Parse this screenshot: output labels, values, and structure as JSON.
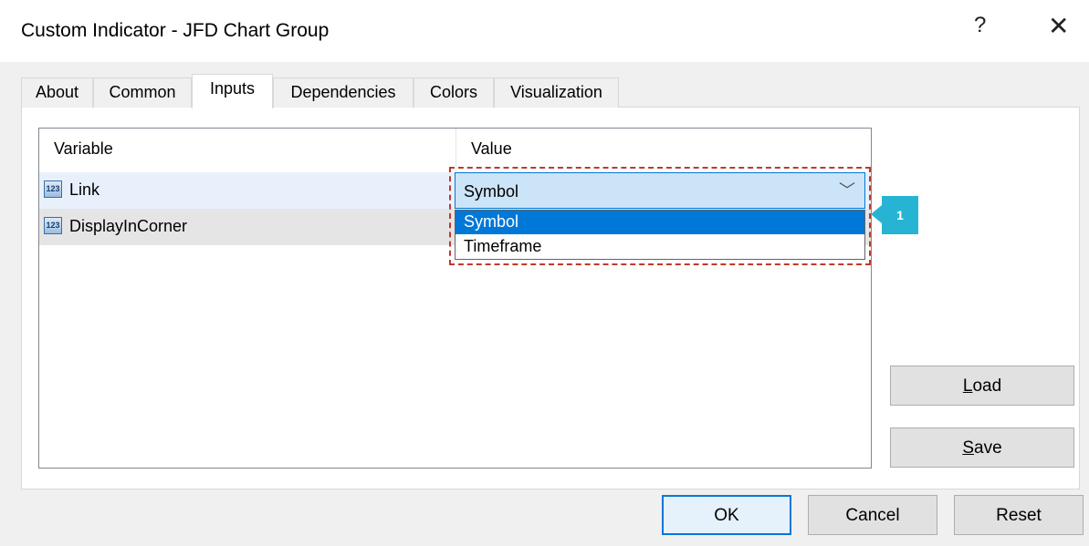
{
  "window": {
    "title": "Custom Indicator - JFD Chart Group",
    "help_label": "?",
    "close_label": "✕"
  },
  "tabs": [
    {
      "label": "About"
    },
    {
      "label": "Common"
    },
    {
      "label": "Inputs",
      "active": true
    },
    {
      "label": "Dependencies"
    },
    {
      "label": "Colors"
    },
    {
      "label": "Visualization"
    }
  ],
  "table": {
    "columns": [
      "Variable",
      "Value"
    ],
    "rows": [
      {
        "icon": "123",
        "variable": "Link",
        "value": "Symbol"
      },
      {
        "icon": "123",
        "variable": "DisplayInCorner",
        "value": ""
      }
    ]
  },
  "dropdown": {
    "selected": "Symbol",
    "arrow": "﹀",
    "options": [
      "Symbol",
      "Timeframe"
    ]
  },
  "callout": {
    "label": "1",
    "color": "#27b4d4"
  },
  "side_buttons": {
    "load_first": "L",
    "load_rest": "oad",
    "save_first": "S",
    "save_rest": "ave"
  },
  "footer_buttons": {
    "ok": "OK",
    "cancel": "Cancel",
    "reset": "Reset"
  },
  "colors": {
    "accent": "#0078d7",
    "highlight_border": "#c0392b"
  }
}
